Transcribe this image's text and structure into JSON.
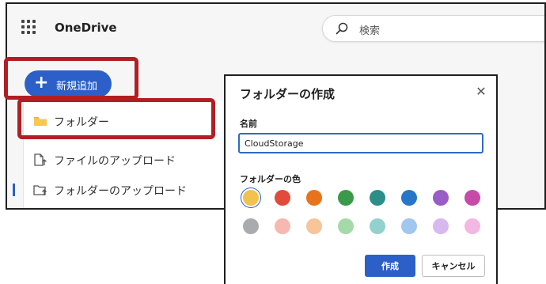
{
  "app": {
    "brand": "OneDrive",
    "search_placeholder": "検索",
    "new_button_label": "新規追加",
    "accent_color": "#2c60c8",
    "highlight_color": "#b11f24"
  },
  "new_menu": {
    "items": [
      {
        "label": "フォルダー",
        "icon": "folder-icon"
      },
      {
        "label": "ファイルのアップロード",
        "icon": "file-upload-icon"
      },
      {
        "label": "フォルダーのアップロード",
        "icon": "folder-upload-icon"
      }
    ]
  },
  "dialog": {
    "title": "フォルダーの作成",
    "name_label": "名前",
    "name_value": "CloudStorage",
    "color_label": "フォルダーの色",
    "colors": [
      "#f2c14e",
      "#e04b3a",
      "#e8731c",
      "#3a9a4a",
      "#2b8f88",
      "#2776c9",
      "#9a5cc6",
      "#c64ba8",
      "#a9acae",
      "#f7b8b0",
      "#f8c49a",
      "#a6d9a8",
      "#93d1cd",
      "#a1c6f0",
      "#d7b8ef",
      "#f2b8e1"
    ],
    "selected_color_index": 0,
    "create_label": "作成",
    "cancel_label": "キャンセル"
  }
}
